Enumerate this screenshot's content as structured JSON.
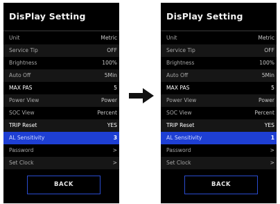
{
  "left": {
    "title": "DisPlay Setting",
    "rows": [
      {
        "label": "Unit",
        "value": "Metric"
      },
      {
        "label": "Service Tip",
        "value": "OFF"
      },
      {
        "label": "Brightness",
        "value": "100%"
      },
      {
        "label": "Auto Off",
        "value": "5Min"
      },
      {
        "label": "MAX PAS",
        "value": "5"
      },
      {
        "label": "Power View",
        "value": "Power"
      },
      {
        "label": "SOC View",
        "value": "Percent"
      },
      {
        "label": "TRIP Reset",
        "value": "YES"
      },
      {
        "label": "AL Sensitivity",
        "value": "3"
      },
      {
        "label": "Password",
        "value": ">"
      },
      {
        "label": "Set Clock",
        "value": ">"
      }
    ],
    "back_label": "BACK"
  },
  "right": {
    "title": "DisPlay Setting",
    "rows": [
      {
        "label": "Unit",
        "value": "Metric"
      },
      {
        "label": "Service Tip",
        "value": "OFF"
      },
      {
        "label": "Brightness",
        "value": "100%"
      },
      {
        "label": "Auto Off",
        "value": "5Min"
      },
      {
        "label": "MAX PAS",
        "value": "5"
      },
      {
        "label": "Power View",
        "value": "Power"
      },
      {
        "label": "SOC View",
        "value": "Percent"
      },
      {
        "label": "TRIP Reset",
        "value": "YES"
      },
      {
        "label": "AL Sensitivity",
        "value": "1"
      },
      {
        "label": "Password",
        "value": ">"
      },
      {
        "label": "Set Clock",
        "value": ">"
      }
    ],
    "back_label": "BACK"
  },
  "selected_row": "AL Sensitivity",
  "colors": {
    "background": "#000000",
    "highlight": "#1e3fd3",
    "button_border": "#2a4cd0",
    "arrow": "#111111"
  },
  "icons": {
    "transition": "arrow-right-icon"
  }
}
